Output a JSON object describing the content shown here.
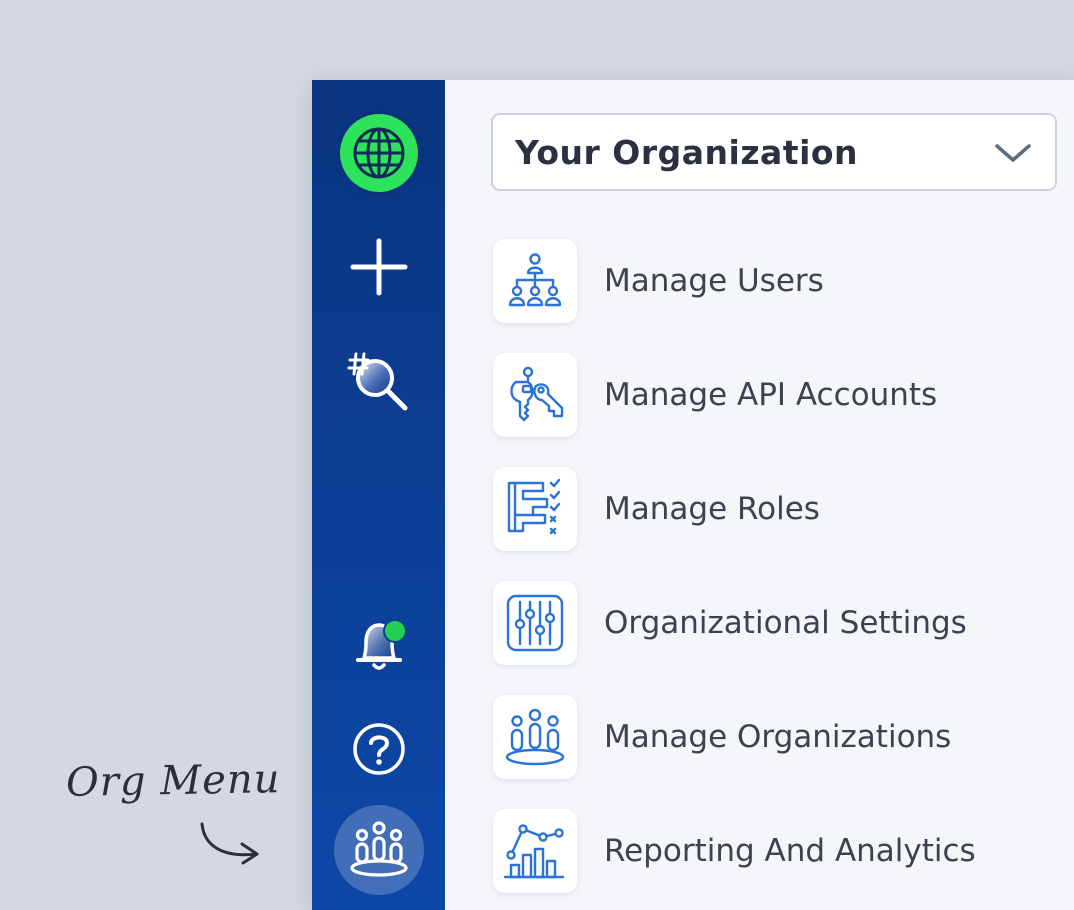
{
  "annotation": {
    "text": "Org Menu"
  },
  "rail": {
    "items": [
      {
        "icon": "globe-icon"
      },
      {
        "icon": "plus-icon"
      },
      {
        "icon": "hashtag-search-icon"
      },
      {
        "icon": "bell-icon",
        "has_notification": true
      },
      {
        "icon": "help-icon"
      },
      {
        "icon": "organization-icon",
        "active": true
      }
    ]
  },
  "org_select": {
    "label": "Your Organization"
  },
  "menu": {
    "items": [
      {
        "label": "Manage Users",
        "icon": "user-hierarchy-icon"
      },
      {
        "label": "Manage API Accounts",
        "icon": "keys-icon"
      },
      {
        "label": "Manage Roles",
        "icon": "roles-checklist-icon"
      },
      {
        "label": "Organizational Settings",
        "icon": "sliders-icon"
      },
      {
        "label": "Manage Organizations",
        "icon": "organizations-icon"
      },
      {
        "label": "Reporting And Analytics",
        "icon": "analytics-chart-icon"
      }
    ]
  },
  "colors": {
    "rail_top": "#0a3580",
    "rail_bottom": "#0d47a8",
    "accent_green": "#2ee35c",
    "icon_blue": "#2a73d9",
    "text": "#3c4350"
  }
}
